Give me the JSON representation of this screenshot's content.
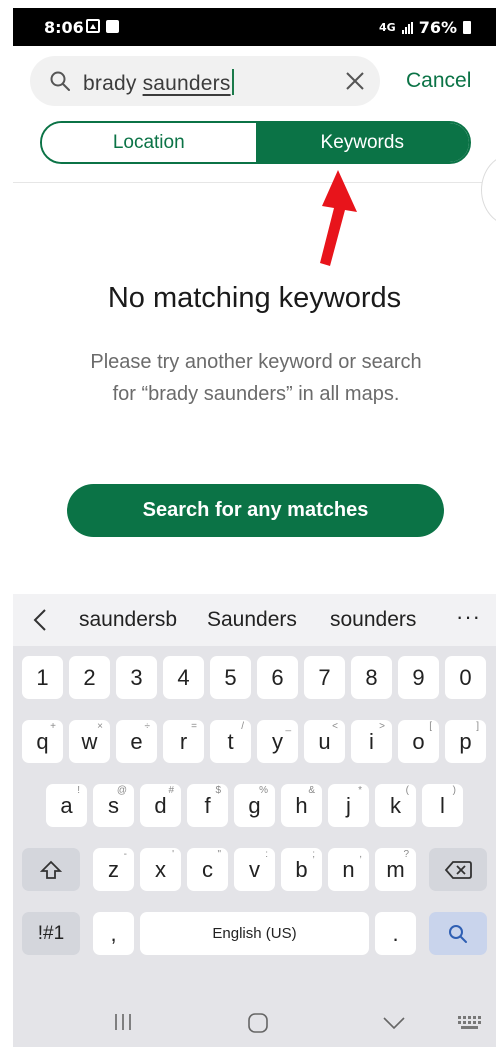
{
  "status_bar": {
    "time": "8:06",
    "network": "4G",
    "battery": "76%"
  },
  "search": {
    "query_plain": "brady ",
    "query_underlined": "saunders",
    "cancel_label": "Cancel"
  },
  "tabs": [
    {
      "label": "Location",
      "selected": false
    },
    {
      "label": "Keywords",
      "selected": true
    }
  ],
  "empty_state": {
    "title": "No matching keywords",
    "description": "Please try another keyword or search for “brady saunders” in all maps.",
    "button_label": "Search for any matches"
  },
  "keyboard": {
    "suggestions": [
      "saundersb",
      "Saunders",
      "sounders"
    ],
    "more_label": "···",
    "number_row": [
      "1",
      "2",
      "3",
      "4",
      "5",
      "6",
      "7",
      "8",
      "9",
      "0"
    ],
    "row1": [
      {
        "key": "q",
        "sub": "+"
      },
      {
        "key": "w",
        "sub": "×"
      },
      {
        "key": "e",
        "sub": "÷"
      },
      {
        "key": "r",
        "sub": "="
      },
      {
        "key": "t",
        "sub": "/"
      },
      {
        "key": "y",
        "sub": "_"
      },
      {
        "key": "u",
        "sub": "<"
      },
      {
        "key": "i",
        "sub": ">"
      },
      {
        "key": "o",
        "sub": "["
      },
      {
        "key": "p",
        "sub": "]"
      }
    ],
    "row2": [
      {
        "key": "a",
        "sub": "!"
      },
      {
        "key": "s",
        "sub": "@"
      },
      {
        "key": "d",
        "sub": "#"
      },
      {
        "key": "f",
        "sub": "$"
      },
      {
        "key": "g",
        "sub": "%"
      },
      {
        "key": "h",
        "sub": "&"
      },
      {
        "key": "j",
        "sub": "*"
      },
      {
        "key": "k",
        "sub": "("
      },
      {
        "key": "l",
        "sub": ")"
      }
    ],
    "row3": [
      {
        "key": "z",
        "sub": "-"
      },
      {
        "key": "x",
        "sub": "'"
      },
      {
        "key": "c",
        "sub": "\""
      },
      {
        "key": "v",
        "sub": ":"
      },
      {
        "key": "b",
        "sub": ";"
      },
      {
        "key": "n",
        "sub": ","
      },
      {
        "key": "m",
        "sub": "?"
      }
    ],
    "symbols_label": "!#1",
    "comma_label": ",",
    "space_label": "English (US)",
    "period_label": "."
  },
  "colors": {
    "accent": "#0b7346",
    "arrow": "#e8141b"
  }
}
